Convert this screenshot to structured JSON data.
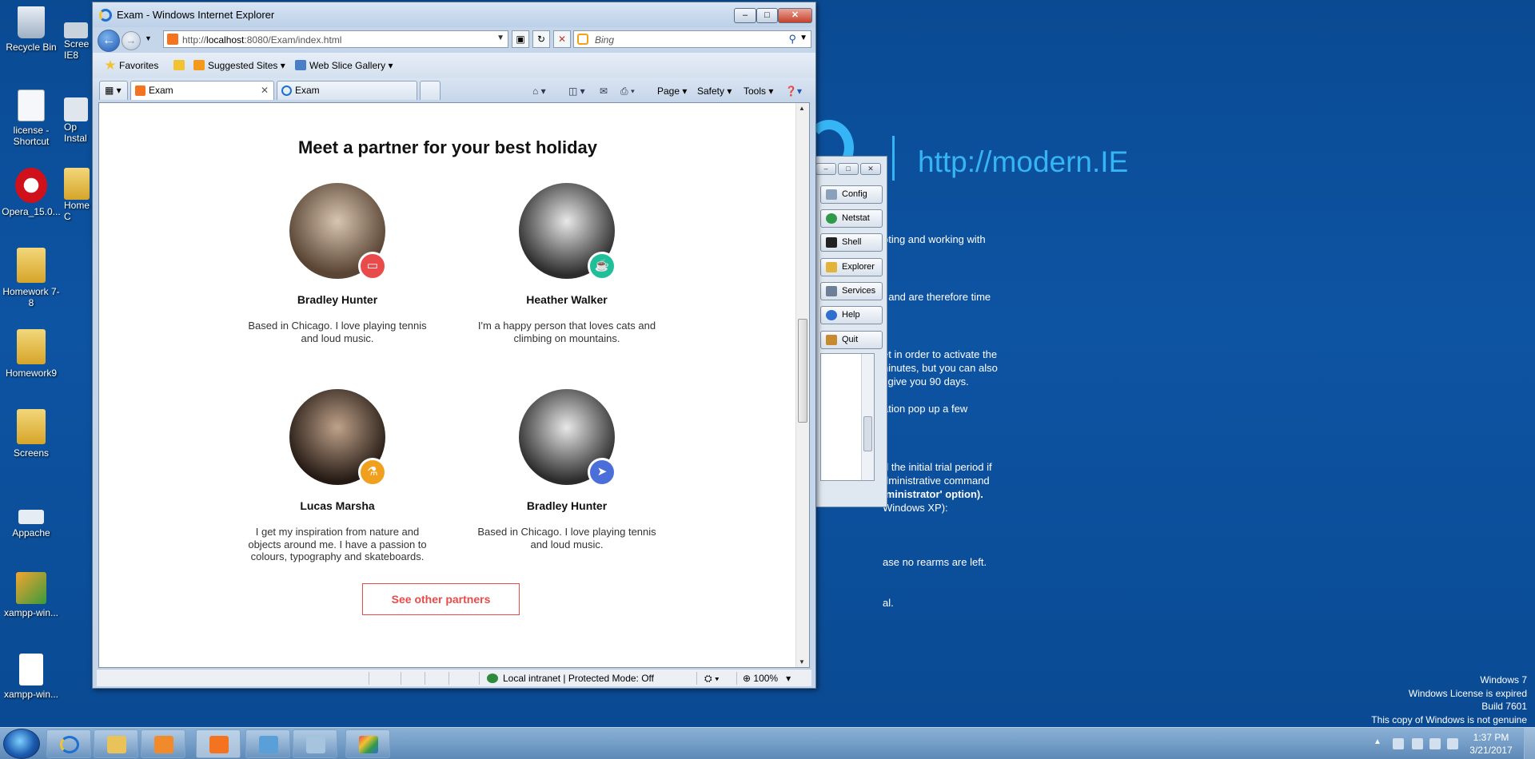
{
  "desktop": {
    "icons": [
      {
        "label": "Recycle Bin",
        "icon": "recycle-bin-icon"
      },
      {
        "label": "Scree IE8",
        "icon": "screenshot-icon"
      },
      {
        "label": "license - Shortcut",
        "icon": "document-shortcut-icon"
      },
      {
        "label": "Op Instal",
        "icon": "installer-icon"
      },
      {
        "label": "Opera_15.0...",
        "icon": "opera-icon"
      },
      {
        "label": "Home - C",
        "icon": "folder-icon"
      },
      {
        "label": "Homework 7-8",
        "icon": "folder-icon"
      },
      {
        "label": "Homework9",
        "icon": "folder-icon"
      },
      {
        "label": "Screens",
        "icon": "folder-icon"
      },
      {
        "label": "Appache",
        "icon": "apache-icon"
      },
      {
        "label": "xampp-win...",
        "icon": "xampp-installer-icon"
      },
      {
        "label": "xampp-win...",
        "icon": "file-icon"
      }
    ],
    "background": {
      "url_text": "http://modern.IE",
      "lines": [
        "pting and working with",
        ", and are therefore time",
        "et in order to activate the",
        "ninutes, but you can also",
        "l give you 90 days.",
        "ation pop up a few",
        "d the initial trial period if",
        "dministrative command",
        "lministrator' option).",
        "Windows XP):",
        "ase no rearms are left.",
        "al."
      ]
    },
    "windows_info": [
      "Windows 7",
      "Windows License is expired",
      "Build 7601",
      "This copy of Windows is not genuine"
    ]
  },
  "panel": {
    "controls": [
      "–",
      "□",
      "✕"
    ],
    "buttons": [
      {
        "label": "Config",
        "icon": "wrench-icon"
      },
      {
        "label": "Netstat",
        "icon": "network-icon"
      },
      {
        "label": "Shell",
        "icon": "terminal-icon"
      },
      {
        "label": "Explorer",
        "icon": "folder-icon"
      },
      {
        "label": "Services",
        "icon": "services-icon"
      },
      {
        "label": "Help",
        "icon": "help-icon"
      },
      {
        "label": "Quit",
        "icon": "quit-icon"
      }
    ]
  },
  "ie": {
    "title": "Exam - Windows Internet Explorer",
    "address_host": "http://",
    "address_domain": "localhost",
    "address_path": ":8080/Exam/index.html",
    "search_placeholder": "Bing",
    "favorites": {
      "favorites_label": "Favorites",
      "suggested_label": "Suggested Sites ▾",
      "webslice_label": "Web Slice Gallery ▾"
    },
    "tabs": [
      {
        "label": "Exam",
        "active": true
      },
      {
        "label": "Exam",
        "active": false
      }
    ],
    "commands": {
      "page": "Page ▾",
      "safety": "Safety ▾",
      "tools": "Tools ▾"
    },
    "status": {
      "zone": "Local intranet | Protected Mode: Off",
      "zoom": "100%"
    }
  },
  "page": {
    "heading": "Meet a partner for your best holiday",
    "partners": [
      {
        "name": "Bradley Hunter",
        "bio": "Based in Chicago. I love playing tennis and loud music.",
        "badge_icon": "tv-icon",
        "badge_color": "#e94b4b"
      },
      {
        "name": "Heather Walker",
        "bio": "I'm a happy person that loves cats and climbing on mountains.",
        "badge_icon": "coffee-icon",
        "badge_color": "#1fbf9a"
      },
      {
        "name": "Lucas Marsha",
        "bio": "I get my inspiration from nature and objects around me. I have a passion to colours, typography and skateboards.",
        "badge_icon": "flask-icon",
        "badge_color": "#f0a01e"
      },
      {
        "name": "Bradley Hunter",
        "bio": "Based in Chicago. I love playing tennis and loud music.",
        "badge_icon": "send-icon",
        "badge_color": "#4a6fd8"
      }
    ],
    "cta_label": "See other partners"
  },
  "taskbar": {
    "apps": [
      "internet-explorer-icon",
      "windows-explorer-icon",
      "media-player-icon",
      "xampp-icon",
      "control-panel-icon",
      "notes-icon",
      "paint-icon"
    ],
    "time": "1:37 PM",
    "date": "3/21/2017"
  }
}
